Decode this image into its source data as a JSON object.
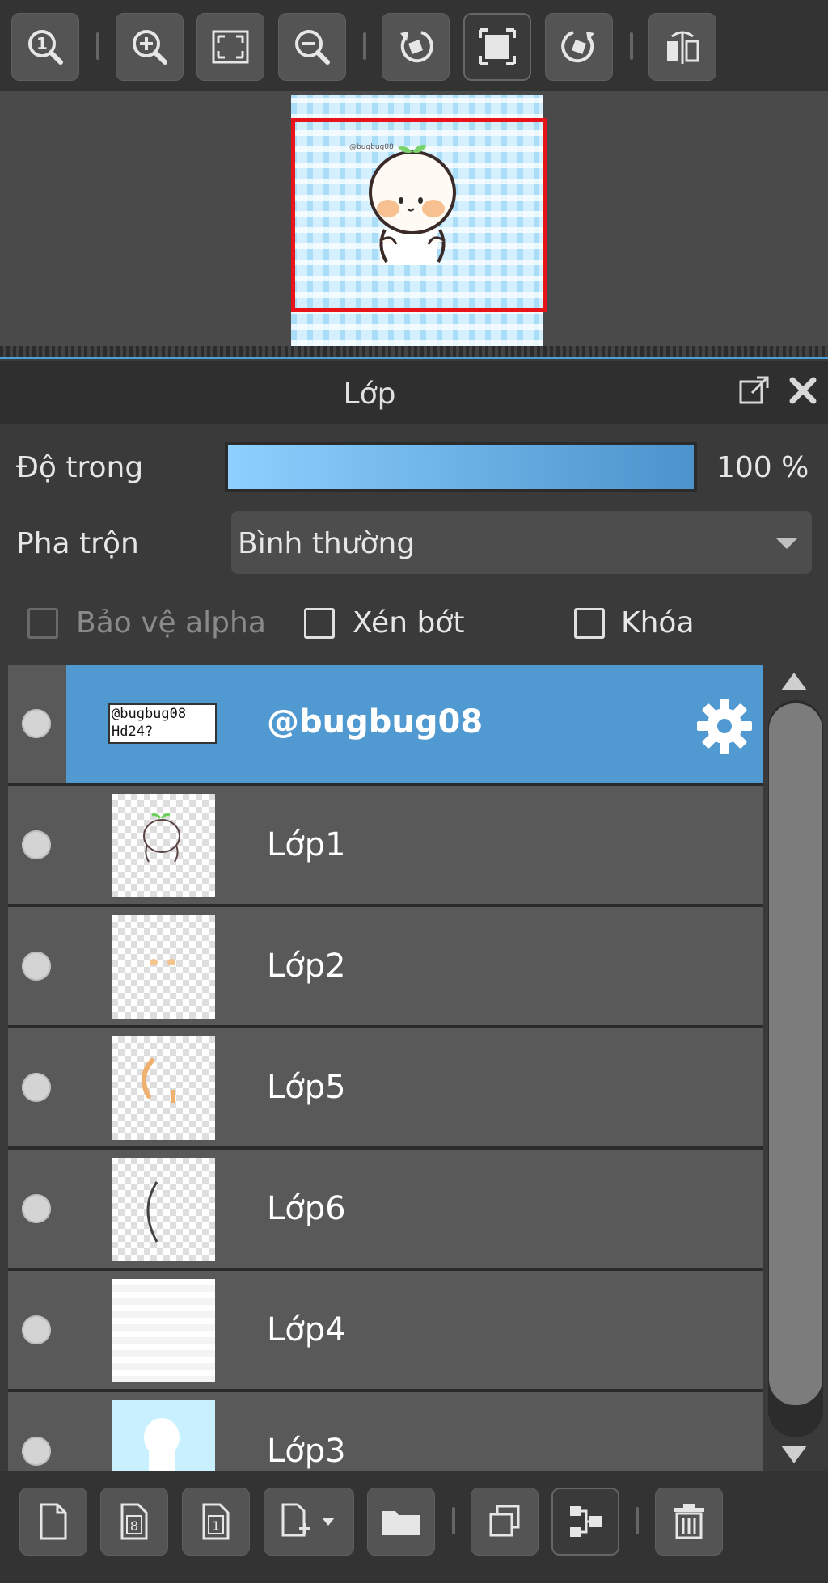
{
  "panel": {
    "title": "Lớp"
  },
  "opacity": {
    "label": "Độ trong",
    "value_text": "100 %",
    "value": 100
  },
  "blend": {
    "label": "Pha trộn",
    "value": "Bình thường"
  },
  "checkboxes": {
    "protect_alpha": {
      "label": "Bảo vệ alpha",
      "checked": false,
      "enabled": false
    },
    "clipping": {
      "label": "Xén bớt",
      "checked": false,
      "enabled": true
    },
    "lock": {
      "label": "Khóa",
      "checked": false,
      "enabled": true
    }
  },
  "layers": [
    {
      "name": "@bugbug08",
      "thumb_text": "@bugbug08 Hd24?",
      "selected": true,
      "visible": true
    },
    {
      "name": "Lớp1",
      "selected": false,
      "visible": true
    },
    {
      "name": "Lớp2",
      "selected": false,
      "visible": true
    },
    {
      "name": "Lớp5",
      "selected": false,
      "visible": true
    },
    {
      "name": "Lớp6",
      "selected": false,
      "visible": true
    },
    {
      "name": "Lớp4",
      "selected": false,
      "visible": true
    },
    {
      "name": "Lớp3",
      "selected": false,
      "visible": true
    }
  ],
  "colors": {
    "selected_row": "#5199d1",
    "row": "#595959",
    "viewport_frame": "#e8141a",
    "opacity_fill_start": "#8ed0ff",
    "opacity_fill_end": "#4b93cc"
  },
  "toolbar_icons": [
    "zoom-actual-icon",
    "zoom-in-icon",
    "fit-screen-icon",
    "zoom-out-icon",
    "rotate-left-icon",
    "reset-view-icon",
    "rotate-right-icon",
    "flip-horizontal-icon"
  ],
  "bottom_icons": [
    "new-layer-icon",
    "new-8bit-layer-icon",
    "new-1bit-layer-icon",
    "add-layer-menu-icon",
    "new-folder-icon",
    "duplicate-layer-icon",
    "merge-down-icon",
    "delete-layer-icon"
  ]
}
